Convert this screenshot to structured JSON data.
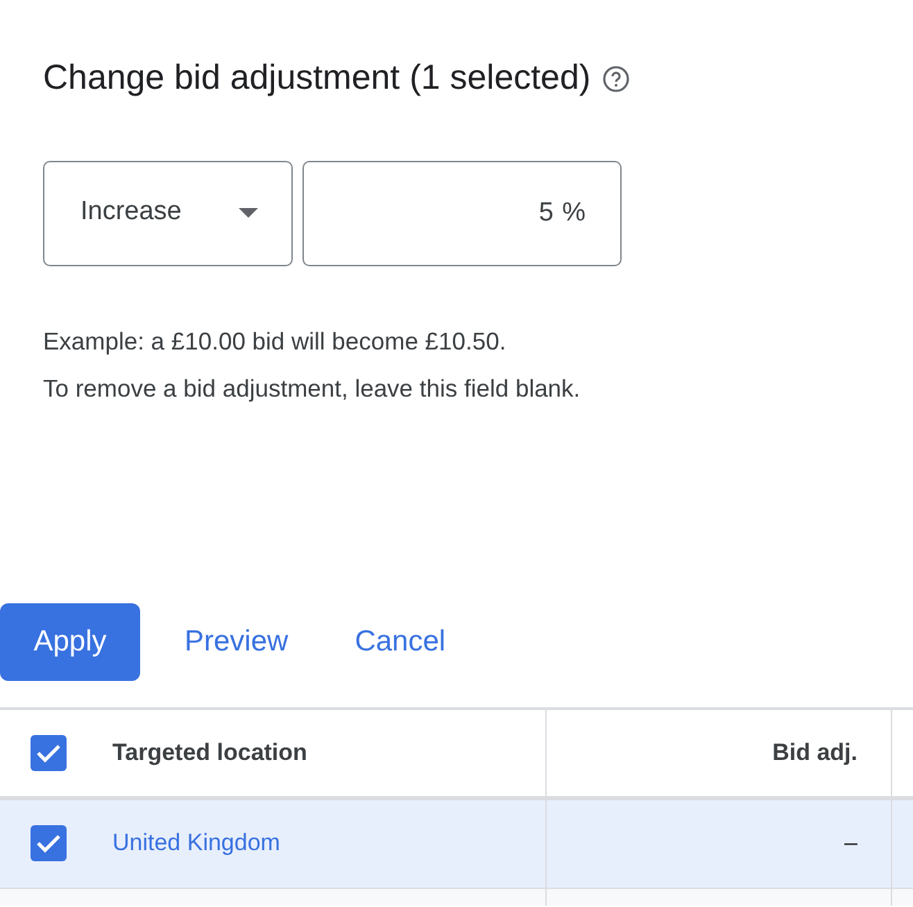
{
  "title": "Change bid adjustment (1 selected)",
  "adjustment": {
    "direction": "Increase",
    "value": "5",
    "unit": "%"
  },
  "help_lines": [
    "Example: a £10.00 bid will become £10.50.",
    "To remove a bid adjustment, leave this field blank."
  ],
  "buttons": [
    {
      "label": "Apply",
      "kind": "primary"
    },
    {
      "label": "Preview",
      "kind": "text"
    },
    {
      "label": "Cancel",
      "kind": "text"
    }
  ],
  "table": {
    "select_all_checked": true,
    "columns": [
      "Targeted location",
      "Bid adj."
    ],
    "rows": [
      {
        "location": "United Kingdom",
        "bid_adj": "–",
        "checked": true,
        "selected": true
      }
    ]
  }
}
